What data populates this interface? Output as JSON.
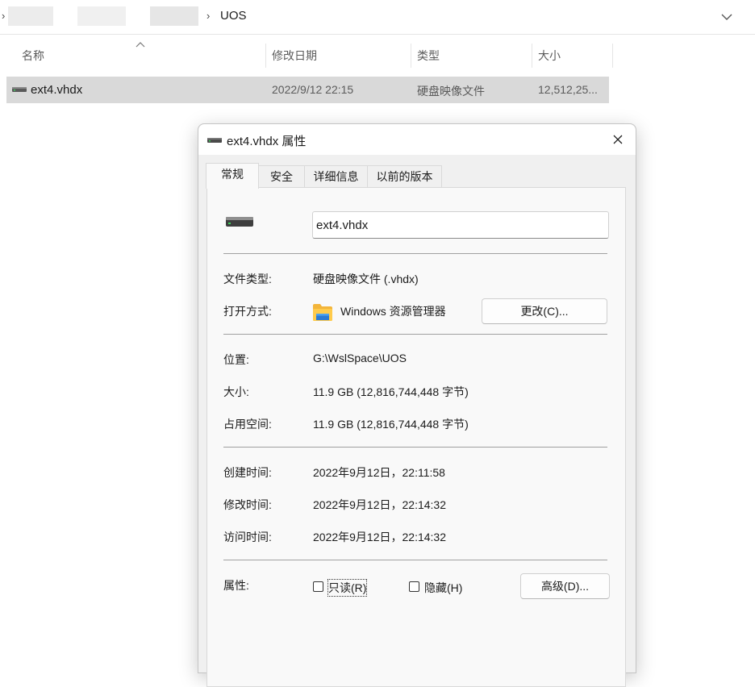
{
  "explorer": {
    "breadcrumb": "UOS",
    "columns": {
      "name": "名称",
      "date": "修改日期",
      "type": "类型",
      "size": "大小"
    },
    "file": {
      "name": "ext4.vhdx",
      "date": "2022/9/12 22:15",
      "type": "硬盘映像文件",
      "size": "12,512,25..."
    }
  },
  "dialog": {
    "title": "ext4.vhdx 属性",
    "tabs": [
      "常规",
      "安全",
      "详细信息",
      "以前的版本"
    ],
    "active_tab": "常规",
    "file_name": "ext4.vhdx",
    "file_type_label": "文件类型:",
    "file_type_value": "硬盘映像文件 (.vhdx)",
    "opens_with_label": "打开方式:",
    "opens_with_value": "Windows 资源管理器",
    "change_button": "更改(C)...",
    "location_label": "位置:",
    "location_value": "G:\\WslSpace\\UOS",
    "size_label": "大小:",
    "size_value": "11.9 GB (12,816,744,448 字节)",
    "size_on_disk_label": "占用空间:",
    "size_on_disk_value": "11.9 GB (12,816,744,448 字节)",
    "created_label": "创建时间:",
    "created_value": "2022年9月12日，22:11:58",
    "modified_label": "修改时间:",
    "modified_value": "2022年9月12日，22:14:32",
    "accessed_label": "访问时间:",
    "accessed_value": "2022年9月12日，22:14:32",
    "attributes_label": "属性:",
    "readonly_label": "只读(R)",
    "hidden_label": "隐藏(H)",
    "readonly_checked": false,
    "hidden_checked": false,
    "advanced_button": "高级(D)..."
  },
  "icons": {
    "drive": "drive-icon",
    "folder": "folder-icon",
    "close": "close-icon",
    "chevron": "chevron-down-icon"
  }
}
